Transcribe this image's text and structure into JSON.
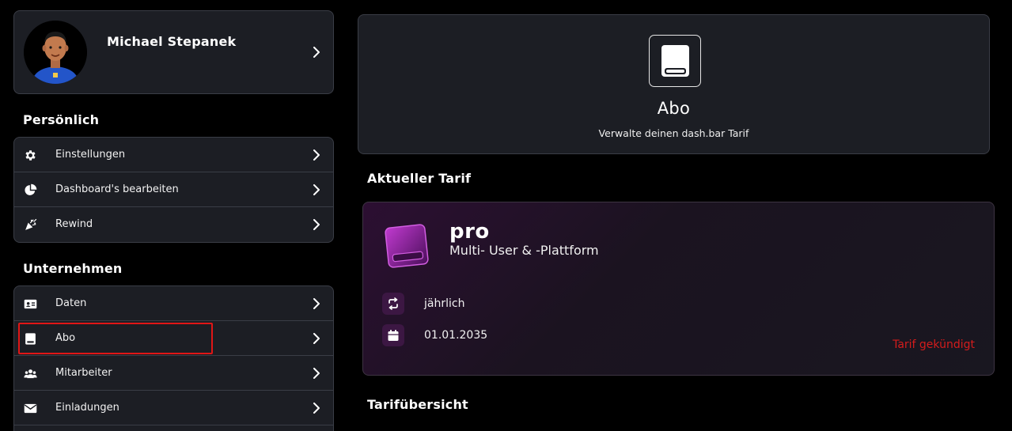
{
  "profile": {
    "name": "Michael Stepanek"
  },
  "sections": {
    "personal": {
      "title": "Persönlich",
      "items": [
        {
          "label": "Einstellungen",
          "icon": "gear-icon"
        },
        {
          "label": "Dashboard's bearbeiten",
          "icon": "pie-chart-icon"
        },
        {
          "label": "Rewind",
          "icon": "confetti-icon"
        }
      ]
    },
    "company": {
      "title": "Unternehmen",
      "items": [
        {
          "label": "Daten",
          "icon": "id-card-icon"
        },
        {
          "label": "Abo",
          "icon": "subscription-icon",
          "highlighted": true
        },
        {
          "label": "Mitarbeiter",
          "icon": "users-icon"
        },
        {
          "label": "Einladungen",
          "icon": "envelope-icon"
        }
      ]
    }
  },
  "abo": {
    "title": "Abo",
    "subtitle": "Verwalte deinen dash.bar Tarif"
  },
  "current_plan": {
    "section_title": "Aktueller Tarif",
    "name": "pro",
    "description": "Multi- User & -Plattform",
    "billing_cycle": "jährlich",
    "date": "01.01.2035",
    "status": "Tarif gekündigt"
  },
  "overview": {
    "title": "Tarifübersicht"
  },
  "colors": {
    "background": "#000000",
    "card": "#1c1e24",
    "border": "#3a3d46",
    "accent_purple": "#8a2c96",
    "highlight_red": "#e01616",
    "cancel_red": "#d41c1c"
  }
}
